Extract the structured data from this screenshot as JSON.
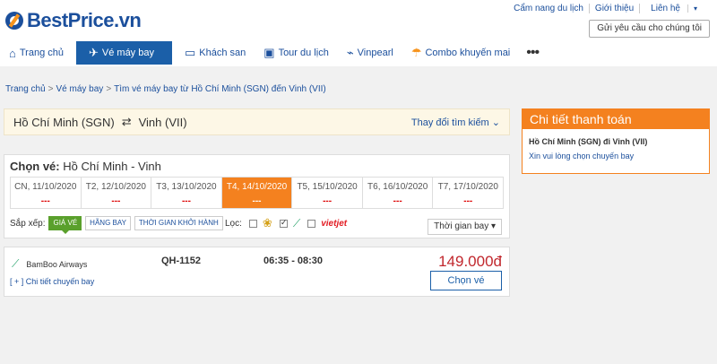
{
  "brand": {
    "name": "BestPrice",
    "tld": ".vn"
  },
  "toplinks": {
    "guide": "Cẩm nang du lịch",
    "about": "Giới thiệu",
    "contact": "Liên hệ"
  },
  "request_button": "Gửi yêu cầu cho chúng tôi",
  "nav": {
    "home": "Trang chủ",
    "flights": "Vé máy bay",
    "hotels": "Khách san",
    "tours": "Tour du lịch",
    "vinpearl": "Vinpearl",
    "combo": "Combo khuyến mai",
    "more": "•••"
  },
  "breadcrumb": {
    "home": "Trang chủ",
    "flights": "Vé máy bay",
    "current": "Tìm vé máy bay từ Hồ Chí Minh (SGN) đến Vinh (VII)",
    "sep": ">"
  },
  "route": {
    "from": "Hồ Chí Minh (SGN)",
    "swap_icon": "⇄",
    "to": "Vinh (VII)",
    "change": "Thay đổi tìm kiếm ⌄"
  },
  "choose": {
    "label": "Chọn vé:",
    "route": "Hồ Chí Minh - Vinh",
    "dates": [
      {
        "label": "CN, 11/10/2020",
        "price": "---"
      },
      {
        "label": "T2, 12/10/2020",
        "price": "---"
      },
      {
        "label": "T3, 13/10/2020",
        "price": "---"
      },
      {
        "label": "T4, 14/10/2020",
        "price": "---"
      },
      {
        "label": "T5, 15/10/2020",
        "price": "---"
      },
      {
        "label": "T6, 16/10/2020",
        "price": "---"
      },
      {
        "label": "T7, 17/10/2020",
        "price": "---"
      }
    ],
    "active_date_index": 3,
    "sort": {
      "label": "Sắp xếp:",
      "price": "GIÁ VÉ",
      "airline": "HÃNG BAY",
      "departure": "THỜI GIAN KHỞI HÀNH"
    },
    "filter": {
      "label": "Lọc:",
      "vietjet": "vietjet"
    },
    "time_select": "Thời gian bay ▾"
  },
  "flight": {
    "airline": "BamBoo Airways",
    "code": "QH-1152",
    "time": "06:35 - 08:30",
    "price": "149.000đ",
    "detail": "[ + ] Chi tiết chuyến bay",
    "choose": "Chọn vé"
  },
  "payment": {
    "title": "Chi tiết thanh toán",
    "route": "Hồ Chí Minh (SGN) đi Vinh (VII)",
    "note": "Xin vui lòng chọn chuyến bay"
  },
  "colors": {
    "brand_blue": "#1b4f9c",
    "accent_orange": "#f4811f",
    "price_red": "#c1272d",
    "bamboo_green": "#27a36b"
  },
  "icons": {
    "home": "home-icon",
    "plane": "plane-icon",
    "bed": "bed-icon",
    "luggage": "luggage-icon",
    "vinpearl": "vinpearl-icon",
    "combo": "umbrella-icon"
  }
}
